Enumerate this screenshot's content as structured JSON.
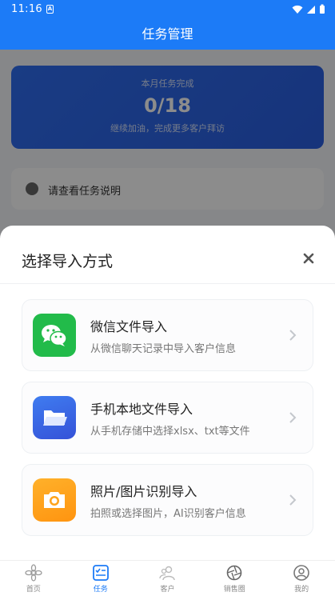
{
  "status_bar": {
    "time": "11:16",
    "sim_label": "A"
  },
  "header": {
    "title": "任务管理"
  },
  "background": {
    "banner_line1": "本月任务完成",
    "banner_value": "0/18",
    "banner_line3": "继续加油，完成更多客户拜访",
    "tip_text": "请查看任务说明"
  },
  "sheet": {
    "title": "选择导入方式",
    "options": [
      {
        "name": "微信文件导入",
        "desc": "从微信聊天记录中导入客户信息",
        "icon": "wechat-icon",
        "color": "#22bb4a"
      },
      {
        "name": "手机本地文件导入",
        "desc": "从手机存储中选择xlsx、txt等文件",
        "icon": "folder-icon",
        "color": "#3a68e8"
      },
      {
        "name": "照片/图片识别导入",
        "desc": "拍照或选择图片，AI识别客户信息",
        "icon": "camera-icon",
        "color": "#ffa31a"
      }
    ]
  },
  "tabbar": {
    "items": [
      {
        "label": "首页",
        "icon": "home-icon",
        "active": false
      },
      {
        "label": "任务",
        "icon": "task-icon",
        "active": true
      },
      {
        "label": "客户",
        "icon": "customers-icon",
        "active": false
      },
      {
        "label": "销售圈",
        "icon": "sales-circle-icon",
        "active": false
      },
      {
        "label": "我的",
        "icon": "profile-icon",
        "active": false
      }
    ]
  },
  "colors": {
    "primary": "#1c7bf7",
    "overlay": "rgba(0,0,0,0.45)"
  }
}
